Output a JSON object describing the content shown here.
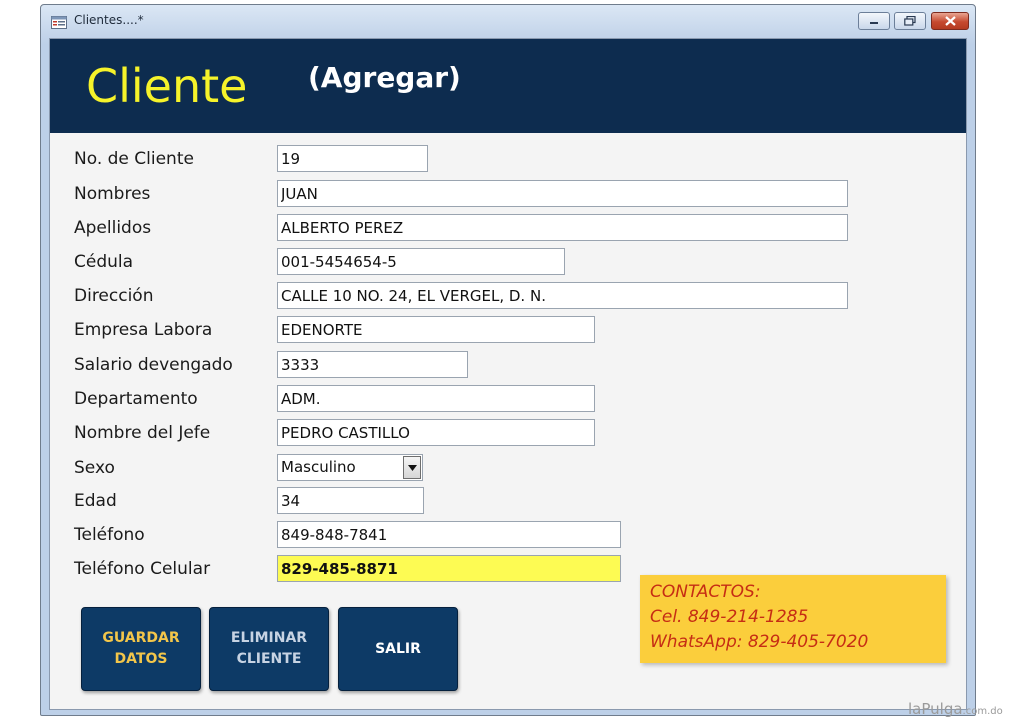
{
  "window": {
    "title": "Clientes....*"
  },
  "header": {
    "title": "Cliente",
    "mode": "(Agregar)"
  },
  "fields": [
    {
      "label": "No. de Cliente",
      "value": "19"
    },
    {
      "label": "Nombres",
      "value": "JUAN"
    },
    {
      "label": "Apellidos",
      "value": "ALBERTO PEREZ"
    },
    {
      "label": "Cédula",
      "value": "001-5454654-5"
    },
    {
      "label": "Dirección",
      "value": "CALLE 10 NO. 24, EL VERGEL, D. N."
    },
    {
      "label": "Empresa Labora",
      "value": "EDENORTE"
    },
    {
      "label": "Salario devengado",
      "value": "3333"
    },
    {
      "label": "Departamento",
      "value": "ADM."
    },
    {
      "label": "Nombre del Jefe",
      "value": "PEDRO CASTILLO"
    },
    {
      "label": "Sexo",
      "value": "Masculino"
    },
    {
      "label": "Edad",
      "value": "34"
    },
    {
      "label": "Teléfono",
      "value": "849-848-7841"
    },
    {
      "label": "Teléfono Celular",
      "value": "829-485-8871"
    }
  ],
  "buttons": {
    "save": "GUARDAR\nDATOS",
    "delete": "ELIMINAR\nCLIENTE",
    "exit": "SALIR"
  },
  "contact": {
    "line1": "CONTACTOS:",
    "line2": "Cel. 849-214-1285",
    "line3": "WhatsApp: 829-405-7020"
  },
  "watermark": {
    "brand": "laPulga",
    "suffix": ".com.do"
  },
  "colors": {
    "header_band": "#0d2c4f",
    "header_title": "#f6f32a",
    "highlight_field": "#fdfb53",
    "contact_box": "#fbce3c",
    "contact_text": "#c62d14",
    "button_bg": "#0d3a66"
  }
}
